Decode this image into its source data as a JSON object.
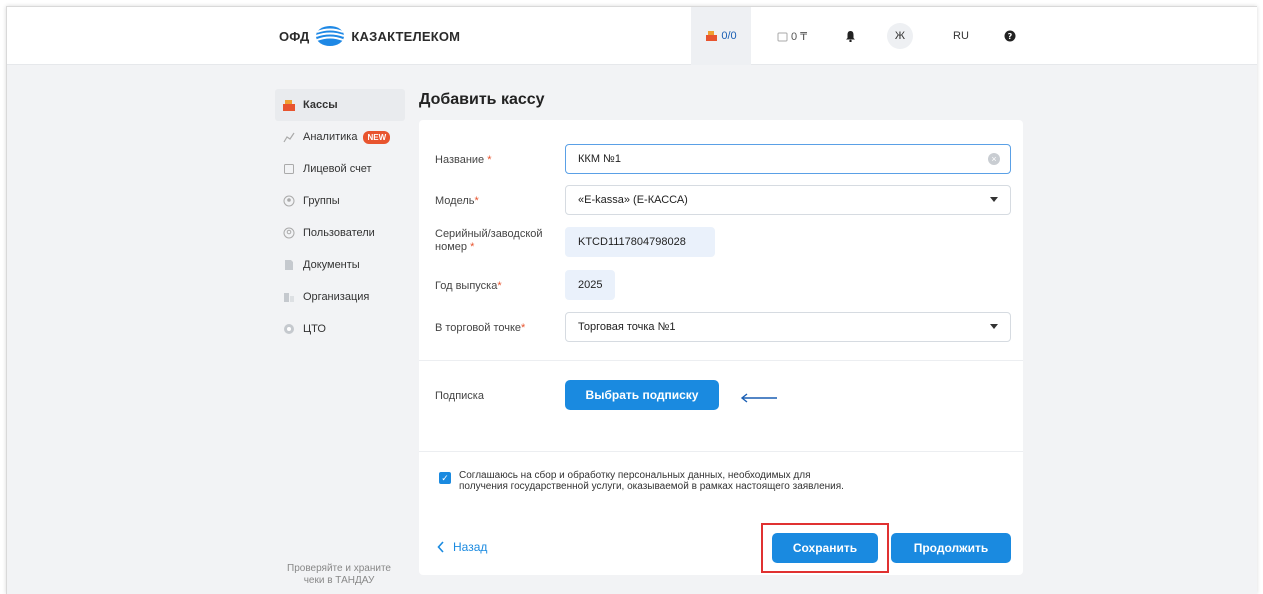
{
  "header": {
    "logo_left": "ОФД",
    "logo_right": "КАЗАКТЕЛЕКОМ",
    "cash_count": "0/0",
    "balance": "0 ₸",
    "user_initial": "Ж",
    "language": "RU"
  },
  "sidebar": {
    "items": [
      {
        "label": "Кассы",
        "icon": "cash-register-icon",
        "active": true
      },
      {
        "label": "Аналитика",
        "icon": "analytics-icon",
        "badge": "NEW"
      },
      {
        "label": "Лицевой счет",
        "icon": "account-icon"
      },
      {
        "label": "Группы",
        "icon": "groups-icon"
      },
      {
        "label": "Пользователи",
        "icon": "users-icon"
      },
      {
        "label": "Документы",
        "icon": "documents-icon"
      },
      {
        "label": "Организация",
        "icon": "organization-icon"
      },
      {
        "label": "ЦТО",
        "icon": "service-center-icon"
      }
    ],
    "footer_line1": "Проверяйте и храните",
    "footer_line2": "чеки в ТАНДАУ"
  },
  "page": {
    "title": "Добавить кассу"
  },
  "form": {
    "name_label": "Название",
    "name_value": "ККМ №1",
    "model_label": "Модель",
    "model_value": "«E-kassa» (E-КАССА)",
    "serial_label_1": "Серийный/заводской",
    "serial_label_2": "номер",
    "serial_value": "KTCD1117804798028",
    "year_label": "Год выпуска",
    "year_value": "2025",
    "point_label": "В торговой точке",
    "point_value": "Торговая точка №1",
    "subscription_label": "Подписка",
    "subscription_button": "Выбрать подписку",
    "required_mark": "*"
  },
  "consent": {
    "checked": true,
    "text": "Соглашаюсь на сбор и обработку персональных данных, необходимых для получения государственной услуги, оказываемой в рамках настоящего заявления."
  },
  "actions": {
    "back": "Назад",
    "save": "Сохранить",
    "continue": "Продолжить"
  },
  "colors": {
    "accent": "#1a8ae0",
    "highlight": "#e03131",
    "badge": "#e8542e"
  }
}
